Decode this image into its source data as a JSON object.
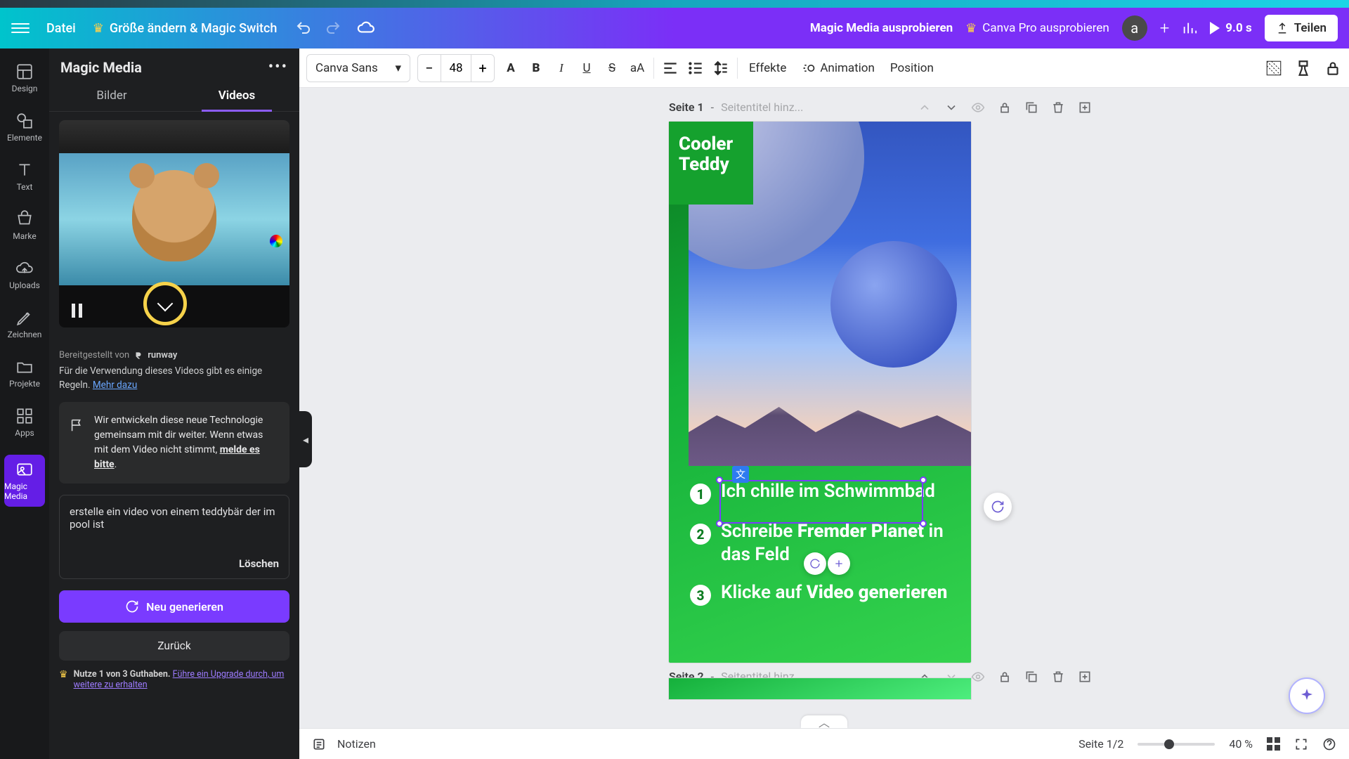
{
  "header": {
    "file": "Datei",
    "resize": "Größe ändern & Magic Switch",
    "try_magic": "Magic Media ausprobieren",
    "try_pro": "Canva Pro ausprobieren",
    "avatar_letter": "a",
    "duration": "9.0 s",
    "share": "Teilen"
  },
  "rail": {
    "design": "Design",
    "elements": "Elemente",
    "text": "Text",
    "brand": "Marke",
    "uploads": "Uploads",
    "draw": "Zeichnen",
    "projects": "Projekte",
    "apps": "Apps",
    "magic_media": "Magic Media"
  },
  "panel": {
    "title": "Magic Media",
    "tab_images": "Bilder",
    "tab_videos": "Videos",
    "provider_prefix": "Bereitgestellt von",
    "provider_name": "runway",
    "rules_text": "Für die Verwendung dieses Videos gibt es einige Regeln.",
    "rules_link": "Mehr dazu",
    "feedback": "Wir entwickeln diese neue Technologie gemeinsam mit dir weiter. Wenn etwas mit dem Video nicht stimmt, ",
    "feedback_link": "melde es bitte",
    "prompt_text": "erstelle ein video von einem teddybär der im pool ist",
    "delete": "Löschen",
    "regenerate": "Neu generieren",
    "back": "Zurück",
    "credits_a": "Nutze 1 von 3 Guthaben.",
    "credits_b": "Führe ein Upgrade durch, um weitere zu erhalten"
  },
  "toolbar": {
    "font": "Canva Sans",
    "size": "48",
    "effects": "Effekte",
    "animation": "Animation",
    "position": "Position"
  },
  "canvas": {
    "page1_label": "Seite 1",
    "page2_label": "Seite 2",
    "page_sep": " - ",
    "page_placeholder": "Seitentitel hinz...",
    "title_l1": "Cooler",
    "title_l2": "Teddy",
    "step1": "Ich chille im Schwimmbad",
    "step2_a": "Schreibe ",
    "step2_b": "Fremder Planet",
    "step2_c": " in das Feld",
    "step3_a": "Klicke auf ",
    "step3_b": "Video generieren"
  },
  "footer": {
    "notes": "Notizen",
    "page_counter": "Seite 1/2",
    "zoom": "40 %"
  }
}
